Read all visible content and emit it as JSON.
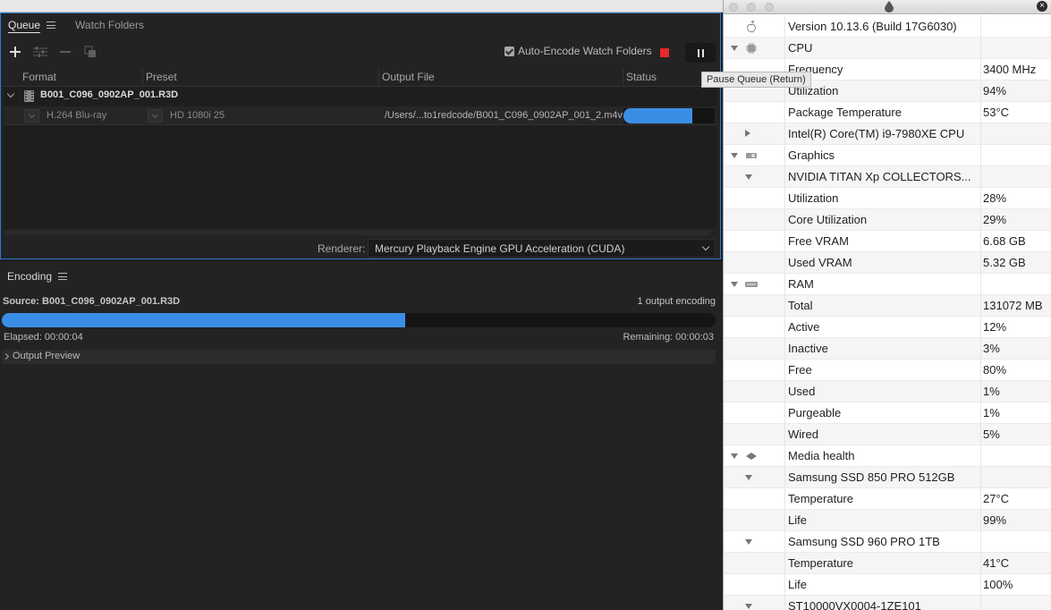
{
  "queue": {
    "tabs": [
      {
        "label": "Queue"
      },
      {
        "label": "Watch Folders"
      }
    ],
    "auto_encode_label": "Auto-Encode Watch Folders",
    "columns": {
      "format": "Format",
      "preset": "Preset",
      "output_file": "Output File",
      "status": "Status"
    },
    "source_name": "B001_C096_0902AP_001.R3D",
    "output": {
      "format": "H.264 Blu-ray",
      "preset": "HD 1080i 25",
      "file": "/Users/...to1redcode/B001_C096_0902AP_001_2.m4v",
      "progress": 0.75
    },
    "renderer_label": "Renderer:",
    "renderer_value": "Mercury Playback Engine GPU Acceleration (CUDA)",
    "tooltip": "Pause Queue (Return)"
  },
  "encoding": {
    "tab_label": "Encoding",
    "source": "Source: B001_C096_0902AP_001.R3D",
    "count": "1 output encoding",
    "progress": 0.565,
    "elapsed": "Elapsed: 00:00:04",
    "remaining": "Remaining: 00:00:03",
    "output_preview": "Output Preview"
  },
  "stats": {
    "rows": [
      {
        "label": "Version 10.13.6 (Build 17G6030)",
        "value": "",
        "indent": 0,
        "icon": "apple-icon"
      },
      {
        "label": "CPU",
        "value": "",
        "indent": 0,
        "expand": "down",
        "icon": "cpu-icon"
      },
      {
        "label": "Frequency",
        "value": "3400 MHz",
        "indent": 1
      },
      {
        "label": "Utilization",
        "value": "94%",
        "indent": 1
      },
      {
        "label": "Package Temperature",
        "value": "53°C",
        "indent": 1
      },
      {
        "label": "Intel(R) Core(TM) i9-7980XE CPU",
        "value": "",
        "indent": 1,
        "expand": "right"
      },
      {
        "label": "Graphics",
        "value": "",
        "indent": 0,
        "expand": "down",
        "icon": "gpu-icon"
      },
      {
        "label": "NVIDIA TITAN Xp COLLECTORS...",
        "value": "",
        "indent": 1,
        "expand": "down"
      },
      {
        "label": "Utilization",
        "value": "28%",
        "indent": 1
      },
      {
        "label": "Core Utilization",
        "value": "29%",
        "indent": 1
      },
      {
        "label": "Free VRAM",
        "value": "6.68 GB",
        "indent": 1
      },
      {
        "label": "Used VRAM",
        "value": "5.32 GB",
        "indent": 1
      },
      {
        "label": "RAM",
        "value": "",
        "indent": 0,
        "expand": "down",
        "icon": "ram-icon"
      },
      {
        "label": "Total",
        "value": "131072 MB",
        "indent": 1
      },
      {
        "label": "Active",
        "value": "12%",
        "indent": 1
      },
      {
        "label": "Inactive",
        "value": "3%",
        "indent": 1
      },
      {
        "label": "Free",
        "value": "80%",
        "indent": 1
      },
      {
        "label": "Used",
        "value": "1%",
        "indent": 1
      },
      {
        "label": "Purgeable",
        "value": "1%",
        "indent": 1
      },
      {
        "label": "Wired",
        "value": "5%",
        "indent": 1
      },
      {
        "label": "Media health",
        "value": "",
        "indent": 0,
        "expand": "down",
        "icon": "disk-icon"
      },
      {
        "label": "Samsung SSD 850 PRO 512GB",
        "value": "",
        "indent": 1,
        "expand": "down"
      },
      {
        "label": "Temperature",
        "value": "27°C",
        "indent": 1
      },
      {
        "label": "Life",
        "value": "99%",
        "indent": 1
      },
      {
        "label": "Samsung SSD 960 PRO 1TB",
        "value": "",
        "indent": 1,
        "expand": "down"
      },
      {
        "label": "Temperature",
        "value": "41°C",
        "indent": 1
      },
      {
        "label": "Life",
        "value": "100%",
        "indent": 1
      },
      {
        "label": "ST10000VX0004-1ZE101",
        "value": "",
        "indent": 1,
        "expand": "down"
      }
    ]
  },
  "colors": {
    "accent": "#3b8ee6",
    "stop": "#e52a2a",
    "focus_border": "#2e7bd6"
  }
}
